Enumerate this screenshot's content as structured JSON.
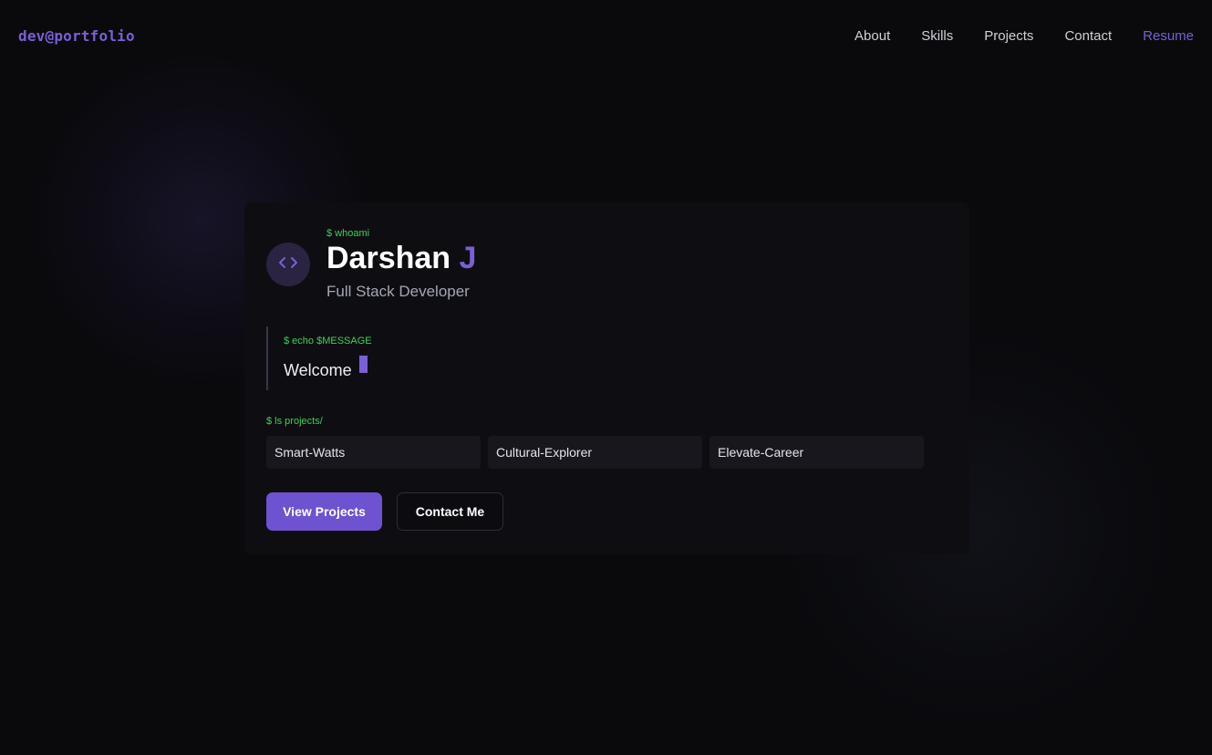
{
  "nav": {
    "logo": "dev@portfolio",
    "links": [
      "About",
      "Skills",
      "Projects",
      "Contact"
    ],
    "resume": "Resume"
  },
  "hero": {
    "whoami_cmd": "$ whoami",
    "first_name": "Darshan",
    "last_initial": "J",
    "role": "Full Stack Developer",
    "echo_cmd": "$ echo $MESSAGE",
    "message": "Welcome",
    "ls_cmd": "$ ls projects/",
    "projects": [
      "Smart-Watts",
      "Cultural-Explorer",
      "Elevate-Career"
    ],
    "primary_button": "View Projects",
    "secondary_button": "Contact Me"
  },
  "icons": {
    "avatar": "code-brackets-icon"
  },
  "colors": {
    "background": "#0a0a0d",
    "accent": "#7b5fd6",
    "terminal_green": "#3ecf5a",
    "card": "#0e0e12"
  }
}
